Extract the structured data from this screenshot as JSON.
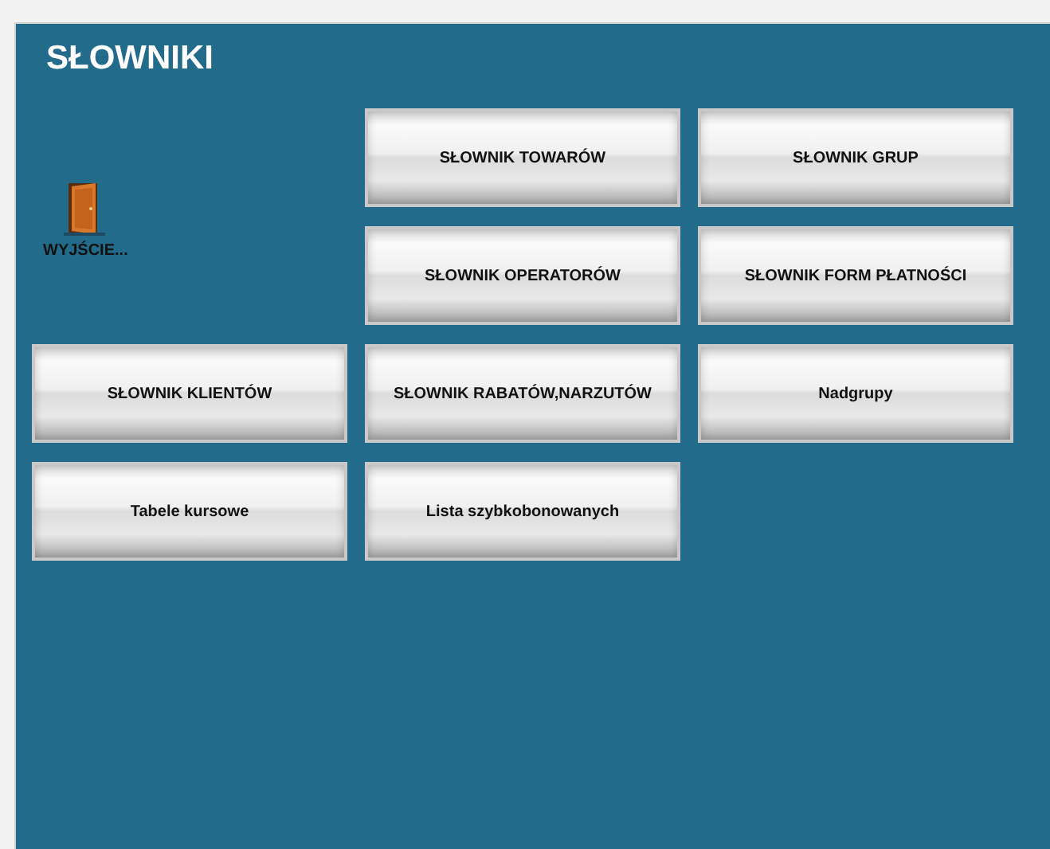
{
  "title": "SŁOWNIKI",
  "exit": {
    "label": "WYJŚCIE..."
  },
  "buttons": [
    {
      "label": "SŁOWNIK TOWARÓW"
    },
    {
      "label": "SŁOWNIK GRUP"
    },
    {
      "label": "SŁOWNIK OPERATORÓW"
    },
    {
      "label": "SŁOWNIK FORM PŁATNOŚCI"
    },
    {
      "label": "SŁOWNIK KLIENTÓW"
    },
    {
      "label": "SŁOWNIK RABATÓW,NARZUTÓW"
    },
    {
      "label": "Nadgrupy"
    },
    {
      "label": "Tabele kursowe"
    },
    {
      "label": "Lista szybkobonowanych"
    }
  ]
}
